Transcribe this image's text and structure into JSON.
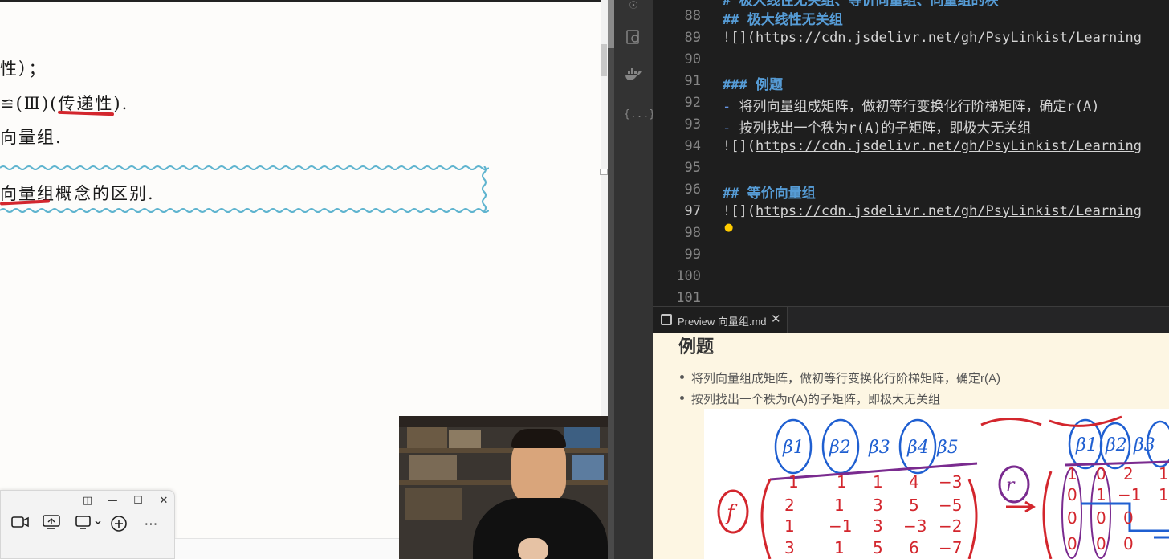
{
  "book": {
    "line1": "性）；",
    "line2": "≌(Ⅲ)(传递性).",
    "line3": "向量组.",
    "boxed_text": "向量组概念的区别."
  },
  "float_toolbar": {
    "buttons": [
      "camera-icon",
      "screen-share-icon",
      "present-icon",
      "add-icon",
      "more-icon"
    ]
  },
  "editor": {
    "lines": [
      {
        "num": "88",
        "prefix": "##",
        "text": " 极大线性无关组",
        "kind": "heading"
      },
      {
        "num": "89",
        "prefix": "![](",
        "text": "https://cdn.jsdelivr.net/gh/PsyLinkist/Learning",
        "kind": "link"
      },
      {
        "num": "90",
        "prefix": "",
        "text": "",
        "kind": "blank"
      },
      {
        "num": "91",
        "prefix": "###",
        "text": " 例题",
        "kind": "heading"
      },
      {
        "num": "92",
        "prefix": "-",
        "text": " 将列向量组成矩阵，做初等行变换化行阶梯矩阵，确定r(A)",
        "kind": "bullet"
      },
      {
        "num": "93",
        "prefix": "-",
        "text": " 按列找出一个秩为r(A)的子矩阵，即极大无关组",
        "kind": "bullet"
      },
      {
        "num": "94",
        "prefix": "![](",
        "text": "https://cdn.jsdelivr.net/gh/PsyLinkist/Learning",
        "kind": "link"
      },
      {
        "num": "95",
        "prefix": "",
        "text": "",
        "kind": "blank"
      },
      {
        "num": "96",
        "prefix": "##",
        "text": " 等价向量组",
        "kind": "heading"
      },
      {
        "num": "97",
        "prefix": "![](",
        "text": "https://cdn.jsdelivr.net/gh/PsyLinkist/Learning",
        "kind": "link"
      },
      {
        "num": "98",
        "prefix": "",
        "text": "",
        "kind": "blank"
      },
      {
        "num": "99",
        "prefix": "",
        "text": "",
        "kind": "blank"
      },
      {
        "num": "100",
        "prefix": "",
        "text": "",
        "kind": "blank"
      },
      {
        "num": "101",
        "prefix": "",
        "text": "",
        "kind": "blank"
      }
    ],
    "active_line": "97"
  },
  "preview": {
    "tab_label": "Preview 向量组.md",
    "heading": "例题",
    "items": [
      "将列向量组成矩阵，做初等行变换化行阶梯矩阵，确定r(A)",
      "按列找出一个秩为r(A)的子矩阵，即极大无关组"
    ]
  },
  "colors": {
    "editor_bg": "#1e1e1e",
    "heading_blue": "#569cd6",
    "preview_bg": "#fdf6e3",
    "red_ink": "#d3262d",
    "blue_ink": "#1f5fd1"
  }
}
